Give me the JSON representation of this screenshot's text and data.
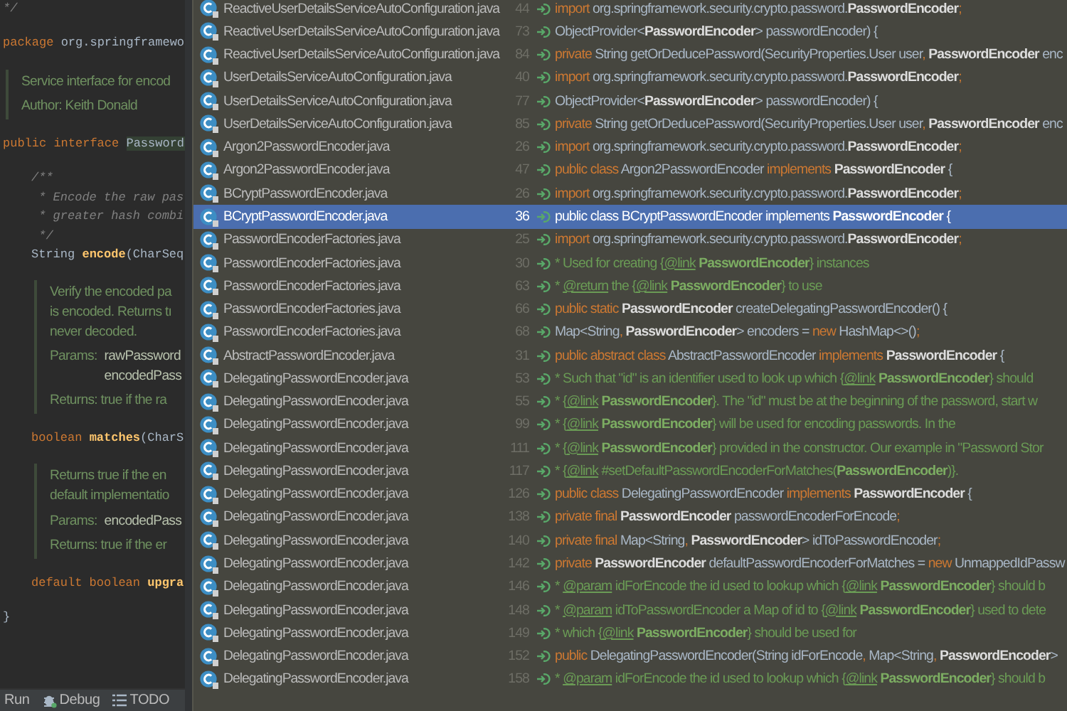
{
  "editor": {
    "blocks": [
      {
        "kind": "code",
        "lines": [
          [
            {
              "kind": "comment",
              "text": "*/"
            }
          ]
        ]
      },
      {
        "kind": "code",
        "lines": [
          [
            {
              "kind": "kw",
              "text": "package "
            },
            {
              "kind": "plain",
              "text": "org.springframewo"
            }
          ]
        ]
      },
      {
        "kind": "doc",
        "sections": [
          {
            "kind": "text",
            "lines": [
              "Service interface for encod"
            ]
          },
          {
            "kind": "note",
            "label": "Author:",
            "text": "Keith Donald"
          }
        ]
      },
      {
        "kind": "code",
        "lines": [
          [
            {
              "kind": "kw",
              "text": "public interface "
            },
            {
              "kind": "hl",
              "text": "Password"
            }
          ]
        ],
        "children": [
          {
            "kind": "code",
            "lines": [
              [
                {
                  "kind": "comment",
                  "text": "/**"
                }
              ],
              [
                {
                  "kind": "comment",
                  "text": " * Encode the raw pas"
                }
              ],
              [
                {
                  "kind": "comment",
                  "text": " * greater hash combi"
                }
              ],
              [
                {
                  "kind": "comment",
                  "text": " */"
                }
              ],
              [
                {
                  "kind": "plain",
                  "text": "String "
                },
                {
                  "kind": "method",
                  "text": "encode"
                },
                {
                  "kind": "plain",
                  "text": "(CharSeq"
                }
              ]
            ]
          },
          {
            "kind": "doc",
            "sections": [
              {
                "kind": "text",
                "lines": [
                  "Verify the encoded pa",
                  "is encoded. Returns tı",
                  "never decoded."
                ]
              },
              {
                "kind": "params",
                "label": "Params:",
                "values": [
                  "rawPassword",
                  "encodedPass"
                ]
              },
              {
                "kind": "note",
                "label": "Returns:",
                "text": "true if the ra"
              }
            ]
          },
          {
            "kind": "code",
            "lines": [
              [
                {
                  "kind": "kw",
                  "text": "boolean "
                },
                {
                  "kind": "method",
                  "text": "matches"
                },
                {
                  "kind": "plain",
                  "text": "(CharS"
                }
              ]
            ]
          },
          {
            "kind": "doc",
            "sections": [
              {
                "kind": "text",
                "lines": [
                  "Returns true if the en",
                  "default implementatio"
                ]
              },
              {
                "kind": "params",
                "label": "Params:",
                "values": [
                  "encodedPass"
                ]
              },
              {
                "kind": "note",
                "label": "Returns:",
                "text": "true if the er"
              }
            ]
          },
          {
            "kind": "code",
            "lines": [
              [
                {
                  "kind": "kw",
                  "text": "default boolean "
                },
                {
                  "kind": "method",
                  "text": "upgra"
                }
              ]
            ]
          }
        ]
      },
      {
        "kind": "code",
        "lines": [
          [
            {
              "kind": "plain",
              "text": "}"
            }
          ]
        ]
      }
    ]
  },
  "status_bar": [
    {
      "kind": "run",
      "label": "Run"
    },
    {
      "kind": "bug",
      "label": "Debug"
    },
    {
      "kind": "list",
      "label": "TODO"
    }
  ],
  "usages": [
    {
      "file": "ReactiveUserDetailsServiceAutoConfiguration.java",
      "line": "44",
      "selected": false,
      "code": [
        {
          "kind": "kw",
          "text": "import"
        },
        {
          "kind": "plain",
          "text": " org.springframework.security.crypto.password."
        },
        {
          "kind": "type",
          "text": "PasswordEncoder"
        },
        {
          "kind": "kw",
          "text": ";"
        }
      ]
    },
    {
      "file": "ReactiveUserDetailsServiceAutoConfiguration.java",
      "line": "73",
      "selected": false,
      "code": [
        {
          "kind": "plain",
          "text": "ObjectProvider<"
        },
        {
          "kind": "type",
          "text": "PasswordEncoder"
        },
        {
          "kind": "plain",
          "text": "> passwordEncoder) {"
        }
      ]
    },
    {
      "file": "ReactiveUserDetailsServiceAutoConfiguration.java",
      "line": "84",
      "selected": false,
      "code": [
        {
          "kind": "kw",
          "text": "private "
        },
        {
          "kind": "plain",
          "text": "String getOrDeducePassword(SecurityProperties.User user"
        },
        {
          "kind": "kw",
          "text": ", "
        },
        {
          "kind": "type",
          "text": "PasswordEncoder"
        },
        {
          "kind": "plain",
          "text": " enc"
        }
      ]
    },
    {
      "file": "UserDetailsServiceAutoConfiguration.java",
      "line": "40",
      "selected": false,
      "code": [
        {
          "kind": "kw",
          "text": "import"
        },
        {
          "kind": "plain",
          "text": " org.springframework.security.crypto.password."
        },
        {
          "kind": "type",
          "text": "PasswordEncoder"
        },
        {
          "kind": "kw",
          "text": ";"
        }
      ]
    },
    {
      "file": "UserDetailsServiceAutoConfiguration.java",
      "line": "77",
      "selected": false,
      "code": [
        {
          "kind": "plain",
          "text": "ObjectProvider<"
        },
        {
          "kind": "type",
          "text": "PasswordEncoder"
        },
        {
          "kind": "plain",
          "text": "> passwordEncoder) {"
        }
      ]
    },
    {
      "file": "UserDetailsServiceAutoConfiguration.java",
      "line": "85",
      "selected": false,
      "code": [
        {
          "kind": "kw",
          "text": "private "
        },
        {
          "kind": "plain",
          "text": "String getOrDeducePassword(SecurityProperties.User user"
        },
        {
          "kind": "kw",
          "text": ", "
        },
        {
          "kind": "type",
          "text": "PasswordEncoder"
        },
        {
          "kind": "plain",
          "text": " enc"
        }
      ]
    },
    {
      "file": "Argon2PasswordEncoder.java",
      "line": "26",
      "selected": false,
      "code": [
        {
          "kind": "kw",
          "text": "import"
        },
        {
          "kind": "plain",
          "text": " org.springframework.security.crypto.password."
        },
        {
          "kind": "type",
          "text": "PasswordEncoder"
        },
        {
          "kind": "kw",
          "text": ";"
        }
      ]
    },
    {
      "file": "Argon2PasswordEncoder.java",
      "line": "47",
      "selected": false,
      "code": [
        {
          "kind": "kw",
          "text": "public class "
        },
        {
          "kind": "plain",
          "text": "Argon2PasswordEncoder "
        },
        {
          "kind": "kw",
          "text": "implements "
        },
        {
          "kind": "type",
          "text": "PasswordEncoder"
        },
        {
          "kind": "plain",
          "text": " {"
        }
      ]
    },
    {
      "file": "BCryptPasswordEncoder.java",
      "line": "26",
      "selected": false,
      "code": [
        {
          "kind": "kw",
          "text": "import"
        },
        {
          "kind": "plain",
          "text": " org.springframework.security.crypto.password."
        },
        {
          "kind": "type",
          "text": "PasswordEncoder"
        },
        {
          "kind": "kw",
          "text": ";"
        }
      ]
    },
    {
      "file": "BCryptPasswordEncoder.java",
      "line": "36",
      "selected": true,
      "code": [
        {
          "kind": "kw",
          "text": "public class "
        },
        {
          "kind": "plain",
          "text": "BCryptPasswordEncoder "
        },
        {
          "kind": "kw",
          "text": "implements "
        },
        {
          "kind": "type",
          "text": "PasswordEncoder"
        },
        {
          "kind": "plain",
          "text": " {"
        }
      ]
    },
    {
      "file": "PasswordEncoderFactories.java",
      "line": "25",
      "selected": false,
      "code": [
        {
          "kind": "kw",
          "text": "import"
        },
        {
          "kind": "plain",
          "text": " org.springframework.security.crypto.password."
        },
        {
          "kind": "type",
          "text": "PasswordEncoder"
        },
        {
          "kind": "kw",
          "text": ";"
        }
      ]
    },
    {
      "file": "PasswordEncoderFactories.java",
      "line": "30",
      "selected": false,
      "code": [
        {
          "kind": "comment",
          "text": "* Used for creating {"
        },
        {
          "kind": "link",
          "text": "@link"
        },
        {
          "kind": "ctype",
          "text": " PasswordEncoder"
        },
        {
          "kind": "comment",
          "text": "} instances"
        }
      ]
    },
    {
      "file": "PasswordEncoderFactories.java",
      "line": "63",
      "selected": false,
      "code": [
        {
          "kind": "comment",
          "text": "* "
        },
        {
          "kind": "link",
          "text": "@return"
        },
        {
          "kind": "comment",
          "text": " the {"
        },
        {
          "kind": "link",
          "text": "@link"
        },
        {
          "kind": "ctype",
          "text": " PasswordEncoder"
        },
        {
          "kind": "comment",
          "text": "} to use"
        }
      ]
    },
    {
      "file": "PasswordEncoderFactories.java",
      "line": "66",
      "selected": false,
      "code": [
        {
          "kind": "kw",
          "text": "public static "
        },
        {
          "kind": "type",
          "text": "PasswordEncoder"
        },
        {
          "kind": "plain",
          "text": " createDelegatingPasswordEncoder() {"
        }
      ]
    },
    {
      "file": "PasswordEncoderFactories.java",
      "line": "68",
      "selected": false,
      "code": [
        {
          "kind": "plain",
          "text": "Map<String"
        },
        {
          "kind": "kw",
          "text": ", "
        },
        {
          "kind": "type",
          "text": "PasswordEncoder"
        },
        {
          "kind": "plain",
          "text": "> encoders = "
        },
        {
          "kind": "kw",
          "text": "new "
        },
        {
          "kind": "plain",
          "text": "HashMap<>()"
        },
        {
          "kind": "kw",
          "text": ";"
        }
      ]
    },
    {
      "file": "AbstractPasswordEncoder.java",
      "line": "31",
      "selected": false,
      "code": [
        {
          "kind": "kw",
          "text": "public abstract class "
        },
        {
          "kind": "plain",
          "text": "AbstractPasswordEncoder "
        },
        {
          "kind": "kw",
          "text": "implements "
        },
        {
          "kind": "type",
          "text": "PasswordEncoder"
        },
        {
          "kind": "plain",
          "text": " {"
        }
      ]
    },
    {
      "file": "DelegatingPasswordEncoder.java",
      "line": "53",
      "selected": false,
      "code": [
        {
          "kind": "comment",
          "text": "* Such that \"id\" is an identifier used to look up which {"
        },
        {
          "kind": "link",
          "text": "@link"
        },
        {
          "kind": "ctype",
          "text": " PasswordEncoder"
        },
        {
          "kind": "comment",
          "text": "} should"
        }
      ]
    },
    {
      "file": "DelegatingPasswordEncoder.java",
      "line": "55",
      "selected": false,
      "code": [
        {
          "kind": "comment",
          "text": "* {"
        },
        {
          "kind": "link",
          "text": "@link"
        },
        {
          "kind": "ctype",
          "text": " PasswordEncoder"
        },
        {
          "kind": "comment",
          "text": "}. The \"id\" must be at the beginning of the password, start w"
        }
      ]
    },
    {
      "file": "DelegatingPasswordEncoder.java",
      "line": "99",
      "selected": false,
      "code": [
        {
          "kind": "comment",
          "text": "* {"
        },
        {
          "kind": "link",
          "text": "@link"
        },
        {
          "kind": "ctype",
          "text": " PasswordEncoder"
        },
        {
          "kind": "comment",
          "text": "} will be used for encoding passwords. In the"
        }
      ]
    },
    {
      "file": "DelegatingPasswordEncoder.java",
      "line": "111",
      "selected": false,
      "code": [
        {
          "kind": "comment",
          "text": "* {"
        },
        {
          "kind": "link",
          "text": "@link"
        },
        {
          "kind": "ctype",
          "text": " PasswordEncoder"
        },
        {
          "kind": "comment",
          "text": "} provided in the constructor. Our example in \"Password Stor"
        }
      ]
    },
    {
      "file": "DelegatingPasswordEncoder.java",
      "line": "117",
      "selected": false,
      "code": [
        {
          "kind": "comment",
          "text": "* {"
        },
        {
          "kind": "link",
          "text": "@link"
        },
        {
          "kind": "comment",
          "text": " #setDefaultPasswordEncoderForMatches("
        },
        {
          "kind": "ctype",
          "text": "PasswordEncoder"
        },
        {
          "kind": "comment",
          "text": ")}."
        }
      ]
    },
    {
      "file": "DelegatingPasswordEncoder.java",
      "line": "126",
      "selected": false,
      "code": [
        {
          "kind": "kw",
          "text": "public class "
        },
        {
          "kind": "plain",
          "text": "DelegatingPasswordEncoder "
        },
        {
          "kind": "kw",
          "text": "implements "
        },
        {
          "kind": "type",
          "text": "PasswordEncoder"
        },
        {
          "kind": "plain",
          "text": " {"
        }
      ]
    },
    {
      "file": "DelegatingPasswordEncoder.java",
      "line": "138",
      "selected": false,
      "code": [
        {
          "kind": "kw",
          "text": "private final "
        },
        {
          "kind": "type",
          "text": "PasswordEncoder"
        },
        {
          "kind": "plain",
          "text": " passwordEncoderForEncode"
        },
        {
          "kind": "kw",
          "text": ";"
        }
      ]
    },
    {
      "file": "DelegatingPasswordEncoder.java",
      "line": "140",
      "selected": false,
      "code": [
        {
          "kind": "kw",
          "text": "private final "
        },
        {
          "kind": "plain",
          "text": "Map<String"
        },
        {
          "kind": "kw",
          "text": ", "
        },
        {
          "kind": "type",
          "text": "PasswordEncoder"
        },
        {
          "kind": "plain",
          "text": "> idToPasswordEncoder"
        },
        {
          "kind": "kw",
          "text": ";"
        }
      ]
    },
    {
      "file": "DelegatingPasswordEncoder.java",
      "line": "142",
      "selected": false,
      "code": [
        {
          "kind": "kw",
          "text": "private "
        },
        {
          "kind": "type",
          "text": "PasswordEncoder"
        },
        {
          "kind": "plain",
          "text": " defaultPasswordEncoderForMatches = "
        },
        {
          "kind": "kw",
          "text": "new "
        },
        {
          "kind": "plain",
          "text": "UnmappedIdPassw"
        }
      ]
    },
    {
      "file": "DelegatingPasswordEncoder.java",
      "line": "146",
      "selected": false,
      "code": [
        {
          "kind": "comment",
          "text": "* "
        },
        {
          "kind": "link",
          "text": "@param"
        },
        {
          "kind": "comment",
          "text": " idForEncode the id used to lookup which {"
        },
        {
          "kind": "link",
          "text": "@link"
        },
        {
          "kind": "ctype",
          "text": " PasswordEncoder"
        },
        {
          "kind": "comment",
          "text": "} should b"
        }
      ]
    },
    {
      "file": "DelegatingPasswordEncoder.java",
      "line": "148",
      "selected": false,
      "code": [
        {
          "kind": "comment",
          "text": "* "
        },
        {
          "kind": "link",
          "text": "@param"
        },
        {
          "kind": "comment",
          "text": " idToPasswordEncoder a Map of id to {"
        },
        {
          "kind": "link",
          "text": "@link"
        },
        {
          "kind": "ctype",
          "text": " PasswordEncoder"
        },
        {
          "kind": "comment",
          "text": "} used to dete"
        }
      ]
    },
    {
      "file": "DelegatingPasswordEncoder.java",
      "line": "149",
      "selected": false,
      "code": [
        {
          "kind": "comment",
          "text": "* which {"
        },
        {
          "kind": "link",
          "text": "@link"
        },
        {
          "kind": "ctype",
          "text": " PasswordEncoder"
        },
        {
          "kind": "comment",
          "text": "} should be used for"
        }
      ]
    },
    {
      "file": "DelegatingPasswordEncoder.java",
      "line": "152",
      "selected": false,
      "code": [
        {
          "kind": "kw",
          "text": "public "
        },
        {
          "kind": "plain",
          "text": "DelegatingPasswordEncoder(String idForEncode"
        },
        {
          "kind": "kw",
          "text": ", "
        },
        {
          "kind": "plain",
          "text": "Map<String"
        },
        {
          "kind": "kw",
          "text": ", "
        },
        {
          "kind": "type",
          "text": "PasswordEncoder"
        },
        {
          "kind": "plain",
          "text": ">"
        }
      ]
    },
    {
      "file": "DelegatingPasswordEncoder.java",
      "line": "158",
      "selected": false,
      "code": [
        {
          "kind": "comment",
          "text": "* "
        },
        {
          "kind": "link",
          "text": "@param"
        },
        {
          "kind": "comment",
          "text": " idForEncode the id used to lookup which {"
        },
        {
          "kind": "link",
          "text": "@link"
        },
        {
          "kind": "ctype",
          "text": " PasswordEncoder"
        },
        {
          "kind": "comment",
          "text": "} should b"
        }
      ]
    }
  ]
}
